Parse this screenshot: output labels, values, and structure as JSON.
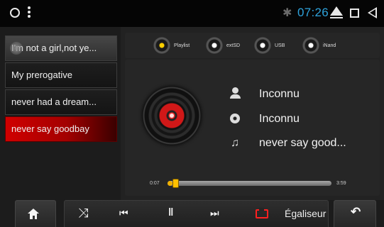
{
  "status_bar": {
    "time": "07:26",
    "icons": [
      "circle-icon",
      "overflow-menu-icon",
      "bluetooth-icon",
      "eject-icon",
      "recents-icon",
      "back-icon"
    ]
  },
  "playlist": {
    "items": [
      {
        "label": "I'm not a girl,not ye...",
        "state": "dim"
      },
      {
        "label": "My prerogative",
        "state": "normal"
      },
      {
        "label": "never had a dream...",
        "state": "normal"
      },
      {
        "label": "never say goodbay",
        "state": "active"
      }
    ]
  },
  "sources": [
    {
      "label": "Playlist",
      "selected": true
    },
    {
      "label": "extSD",
      "selected": false
    },
    {
      "label": "USB",
      "selected": false
    },
    {
      "label": "iNand",
      "selected": false
    }
  ],
  "now_playing": {
    "artist": "Inconnu",
    "album": "Inconnu",
    "title": "never say good..."
  },
  "progress": {
    "current": "0:07",
    "total": "3:59",
    "fraction": 0.03
  },
  "controls": {
    "equalizer_label": "Égaliseur"
  },
  "colors": {
    "accent_time": "#2ea3dc",
    "active_item": "#d00000",
    "progress": "#ffc000",
    "repeat": "#ff2020"
  }
}
